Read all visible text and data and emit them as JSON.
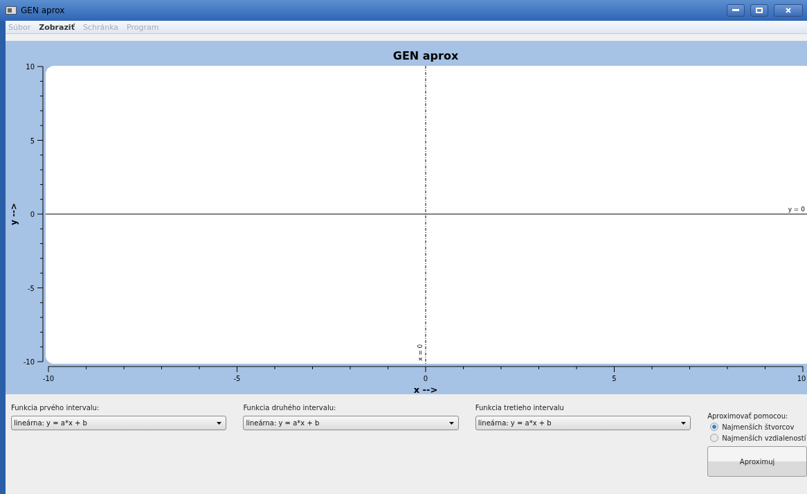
{
  "window": {
    "title": "GEN aprox"
  },
  "menu": [
    {
      "label": "Súbor",
      "disabled": true
    },
    {
      "label": "Zobraziť",
      "disabled": false
    },
    {
      "label": "Schránka",
      "disabled": true
    },
    {
      "label": "Program",
      "disabled": true
    }
  ],
  "chart": {
    "chart_data": {
      "type": "line",
      "title": "GEN aprox",
      "xlabel": "x -->",
      "ylabel": "y -->",
      "xlim": [
        -10,
        10
      ],
      "ylim": [
        -10,
        10
      ],
      "xticks": [
        -10,
        -5,
        0,
        5,
        10
      ],
      "yticks": [
        -10,
        -5,
        0,
        5,
        10
      ],
      "ref_lines": [
        {
          "axis": "y",
          "value": 0,
          "label": "y = 0"
        },
        {
          "axis": "x",
          "value": 0,
          "label": "x = 0"
        }
      ]
    }
  },
  "intervals": [
    {
      "label": "Funkcia prvého intervalu:",
      "value": "lineárna: y = a*x + b"
    },
    {
      "label": "Funkcia druhého intervalu:",
      "value": "lineárna: y = a*x + b"
    },
    {
      "label": "Funkcia tretieho intervalu",
      "value": "lineárna: y = a*x + b"
    }
  ],
  "method": {
    "label": "Aproximovať pomocou:",
    "options": [
      {
        "label": "Najmenších štvorcov",
        "selected": true
      },
      {
        "label": "Najmenších vzdialeností",
        "selected": false
      }
    ]
  },
  "buttons": [
    "Aproximuj"
  ]
}
